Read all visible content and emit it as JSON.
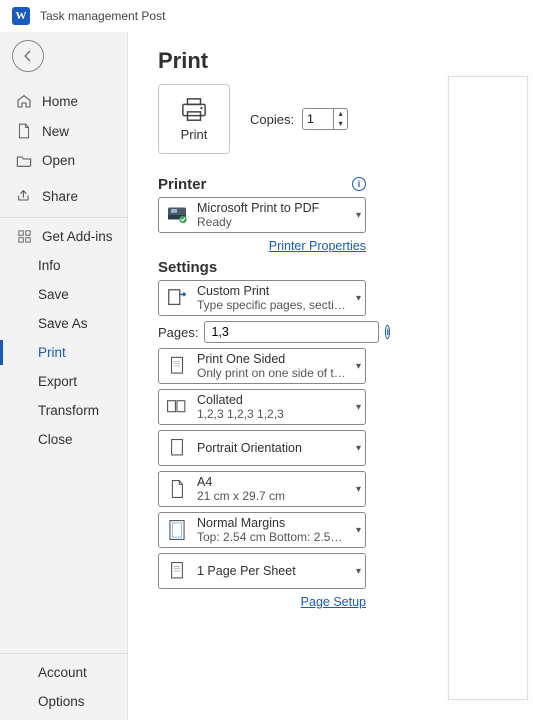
{
  "window": {
    "app_letter": "W",
    "title": "Task management Post"
  },
  "sidebar": {
    "primary": [
      {
        "label": "Home"
      },
      {
        "label": "New"
      },
      {
        "label": "Open"
      },
      {
        "label": "Share"
      }
    ],
    "addins_label": "Get Add-ins",
    "file_ops": [
      {
        "label": "Info"
      },
      {
        "label": "Save"
      },
      {
        "label": "Save As"
      },
      {
        "label": "Print",
        "selected": true
      },
      {
        "label": "Export"
      },
      {
        "label": "Transform"
      },
      {
        "label": "Close"
      }
    ],
    "bottom": [
      {
        "label": "Account"
      },
      {
        "label": "Options"
      }
    ]
  },
  "page": {
    "title": "Print",
    "print_button": "Print",
    "copies_label": "Copies:",
    "copies_value": "1"
  },
  "printer": {
    "heading": "Printer",
    "name": "Microsoft Print to PDF",
    "status": "Ready",
    "properties_link": "Printer Properties"
  },
  "settings": {
    "heading": "Settings",
    "entries": {
      "range": {
        "line1": "Custom Print",
        "line2": "Type specific pages, sections..."
      },
      "pages_label": "Pages:",
      "pages_value": "1,3",
      "sides": {
        "line1": "Print One Sided",
        "line2": "Only print on one side of the..."
      },
      "collate": {
        "line1": "Collated",
        "line2": "1,2,3    1,2,3    1,2,3"
      },
      "orientation": {
        "line1": "Portrait Orientation"
      },
      "paper": {
        "line1": "A4",
        "line2": "21 cm x 29.7 cm"
      },
      "margins": {
        "line1": "Normal Margins",
        "line2": "Top: 2.54 cm Bottom: 2.54 cm..."
      },
      "sheet": {
        "line1": "1 Page Per Sheet"
      }
    },
    "page_setup_link": "Page Setup"
  }
}
